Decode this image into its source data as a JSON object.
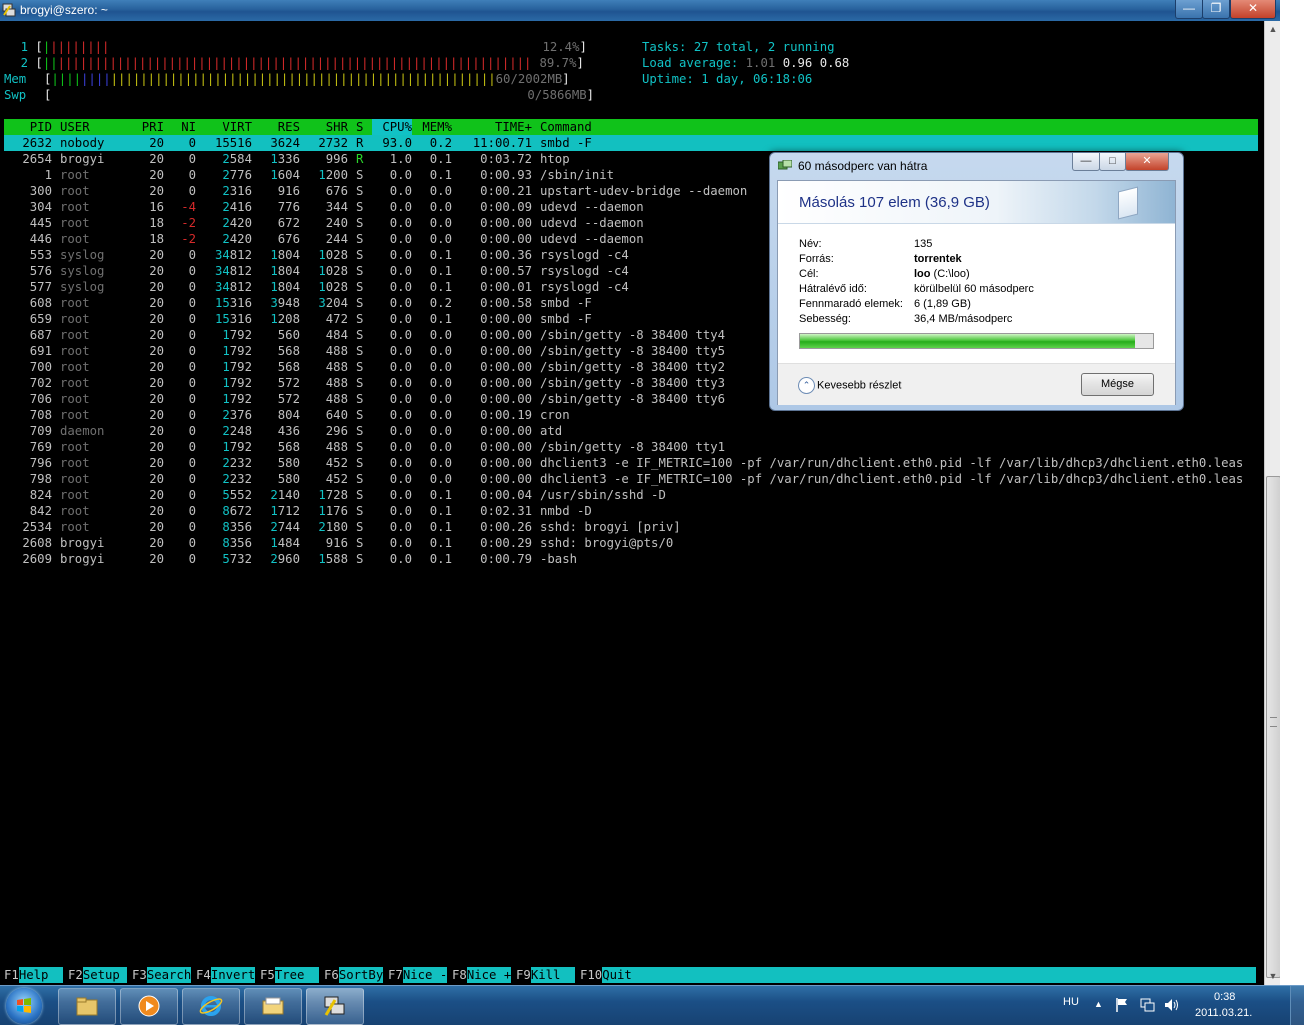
{
  "window": {
    "title": "brogyi@szero: ~"
  },
  "htop": {
    "meters": [
      {
        "label": "1",
        "value": "12.4%"
      },
      {
        "label": "2",
        "value": "89.7%"
      },
      {
        "label": "Mem",
        "value": "60/2002MB"
      },
      {
        "label": "Swp",
        "value": "0/5866MB"
      }
    ],
    "tasks_label": "Tasks:",
    "tasks_value": "27 total,",
    "running": "2 running",
    "load_label": "Load average:",
    "load1": "1.01",
    "load5": "0.96",
    "load15": "0.68",
    "uptime_label": "Uptime:",
    "uptime_value": "1 day, 06:18:06",
    "columns": [
      "PID",
      "USER",
      "PRI",
      "NI",
      "VIRT",
      "RES",
      "SHR",
      "S",
      "CPU%",
      "MEM%",
      "TIME+",
      "Command"
    ],
    "processes": [
      [
        "2632",
        "nobody",
        "20",
        "0",
        "15516",
        "3624",
        "2732",
        "R",
        "93.0",
        "0.2",
        "11:00.71",
        "smbd -F"
      ],
      [
        "2654",
        "brogyi",
        "20",
        "0",
        "2584",
        "1336",
        "996",
        "R",
        "1.0",
        "0.1",
        "0:03.72",
        "htop"
      ],
      [
        "1",
        "root",
        "20",
        "0",
        "2776",
        "1604",
        "1200",
        "S",
        "0.0",
        "0.1",
        "0:00.93",
        "/sbin/init"
      ],
      [
        "300",
        "root",
        "20",
        "0",
        "2316",
        "916",
        "676",
        "S",
        "0.0",
        "0.0",
        "0:00.21",
        "upstart-udev-bridge --daemon"
      ],
      [
        "304",
        "root",
        "16",
        "-4",
        "2416",
        "776",
        "344",
        "S",
        "0.0",
        "0.0",
        "0:00.09",
        "udevd --daemon"
      ],
      [
        "445",
        "root",
        "18",
        "-2",
        "2420",
        "672",
        "240",
        "S",
        "0.0",
        "0.0",
        "0:00.00",
        "udevd --daemon"
      ],
      [
        "446",
        "root",
        "18",
        "-2",
        "2420",
        "676",
        "244",
        "S",
        "0.0",
        "0.0",
        "0:00.00",
        "udevd --daemon"
      ],
      [
        "553",
        "syslog",
        "20",
        "0",
        "34812",
        "1804",
        "1028",
        "S",
        "0.0",
        "0.1",
        "0:00.36",
        "rsyslogd -c4"
      ],
      [
        "576",
        "syslog",
        "20",
        "0",
        "34812",
        "1804",
        "1028",
        "S",
        "0.0",
        "0.1",
        "0:00.57",
        "rsyslogd -c4"
      ],
      [
        "577",
        "syslog",
        "20",
        "0",
        "34812",
        "1804",
        "1028",
        "S",
        "0.0",
        "0.1",
        "0:00.01",
        "rsyslogd -c4"
      ],
      [
        "608",
        "root",
        "20",
        "0",
        "15316",
        "3948",
        "3204",
        "S",
        "0.0",
        "0.2",
        "0:00.58",
        "smbd -F"
      ],
      [
        "659",
        "root",
        "20",
        "0",
        "15316",
        "1208",
        "472",
        "S",
        "0.0",
        "0.1",
        "0:00.00",
        "smbd -F"
      ],
      [
        "687",
        "root",
        "20",
        "0",
        "1792",
        "560",
        "484",
        "S",
        "0.0",
        "0.0",
        "0:00.00",
        "/sbin/getty -8 38400 tty4"
      ],
      [
        "691",
        "root",
        "20",
        "0",
        "1792",
        "568",
        "488",
        "S",
        "0.0",
        "0.0",
        "0:00.00",
        "/sbin/getty -8 38400 tty5"
      ],
      [
        "700",
        "root",
        "20",
        "0",
        "1792",
        "568",
        "488",
        "S",
        "0.0",
        "0.0",
        "0:00.00",
        "/sbin/getty -8 38400 tty2"
      ],
      [
        "702",
        "root",
        "20",
        "0",
        "1792",
        "572",
        "488",
        "S",
        "0.0",
        "0.0",
        "0:00.00",
        "/sbin/getty -8 38400 tty3"
      ],
      [
        "706",
        "root",
        "20",
        "0",
        "1792",
        "572",
        "488",
        "S",
        "0.0",
        "0.0",
        "0:00.00",
        "/sbin/getty -8 38400 tty6"
      ],
      [
        "708",
        "root",
        "20",
        "0",
        "2376",
        "804",
        "640",
        "S",
        "0.0",
        "0.0",
        "0:00.19",
        "cron"
      ],
      [
        "709",
        "daemon",
        "20",
        "0",
        "2248",
        "436",
        "296",
        "S",
        "0.0",
        "0.0",
        "0:00.00",
        "atd"
      ],
      [
        "769",
        "root",
        "20",
        "0",
        "1792",
        "568",
        "488",
        "S",
        "0.0",
        "0.0",
        "0:00.00",
        "/sbin/getty -8 38400 tty1"
      ],
      [
        "796",
        "root",
        "20",
        "0",
        "2232",
        "580",
        "452",
        "S",
        "0.0",
        "0.0",
        "0:00.00",
        "dhclient3 -e IF_METRIC=100 -pf /var/run/dhclient.eth0.pid -lf /var/lib/dhcp3/dhclient.eth0.leas"
      ],
      [
        "798",
        "root",
        "20",
        "0",
        "2232",
        "580",
        "452",
        "S",
        "0.0",
        "0.0",
        "0:00.00",
        "dhclient3 -e IF_METRIC=100 -pf /var/run/dhclient.eth0.pid -lf /var/lib/dhcp3/dhclient.eth0.leas"
      ],
      [
        "824",
        "root",
        "20",
        "0",
        "5552",
        "2140",
        "1728",
        "S",
        "0.0",
        "0.1",
        "0:00.04",
        "/usr/sbin/sshd -D"
      ],
      [
        "842",
        "root",
        "20",
        "0",
        "8672",
        "1712",
        "1176",
        "S",
        "0.0",
        "0.1",
        "0:02.31",
        "nmbd -D"
      ],
      [
        "2534",
        "root",
        "20",
        "0",
        "8356",
        "2744",
        "2180",
        "S",
        "0.0",
        "0.1",
        "0:00.26",
        "sshd: brogyi [priv]"
      ],
      [
        "2608",
        "brogyi",
        "20",
        "0",
        "8356",
        "1484",
        "916",
        "S",
        "0.0",
        "0.1",
        "0:00.29",
        "sshd: brogyi@pts/0"
      ],
      [
        "2609",
        "brogyi",
        "20",
        "0",
        "5732",
        "2960",
        "1588",
        "S",
        "0.0",
        "0.1",
        "0:00.79",
        "-bash"
      ]
    ],
    "fkeys": [
      {
        "key": "F1",
        "label": "Help  "
      },
      {
        "key": "F2",
        "label": "Setup "
      },
      {
        "key": "F3",
        "label": "Search"
      },
      {
        "key": "F4",
        "label": "Invert"
      },
      {
        "key": "F5",
        "label": "Tree  "
      },
      {
        "key": "F6",
        "label": "SortBy"
      },
      {
        "key": "F7",
        "label": "Nice -"
      },
      {
        "key": "F8",
        "label": "Nice +"
      },
      {
        "key": "F9",
        "label": "Kill  "
      },
      {
        "key": "F10",
        "label": "Quit"
      }
    ]
  },
  "dialog": {
    "title": "60 másodperc van hátra",
    "heading": "Másolás 107 elem (36,9 GB)",
    "rows": [
      {
        "label": "Név:",
        "value": "135",
        "extra": ""
      },
      {
        "label": "Forrás:",
        "value": "torrentek",
        "extra": ""
      },
      {
        "label": "Cél:",
        "value": "loo",
        "extra": " (C:\\loo)"
      },
      {
        "label": "Hátralévő idő:",
        "value": "körülbelül 60 másodperc",
        "extra": ""
      },
      {
        "label": "Fennmaradó elemek:",
        "value": "6 (1,89 GB)",
        "extra": ""
      },
      {
        "label": "Sebesség:",
        "value": "36,4 MB/másodperc",
        "extra": ""
      }
    ],
    "progress": 0.95,
    "less_details": "Kevesebb részlet",
    "cancel": "Mégse"
  },
  "taskbar": {
    "language": "HU",
    "time": "0:38",
    "date": "2011.03.21.",
    "apps": [
      "windows-explorer",
      "media-player",
      "internet-explorer",
      "folder",
      "putty"
    ]
  }
}
